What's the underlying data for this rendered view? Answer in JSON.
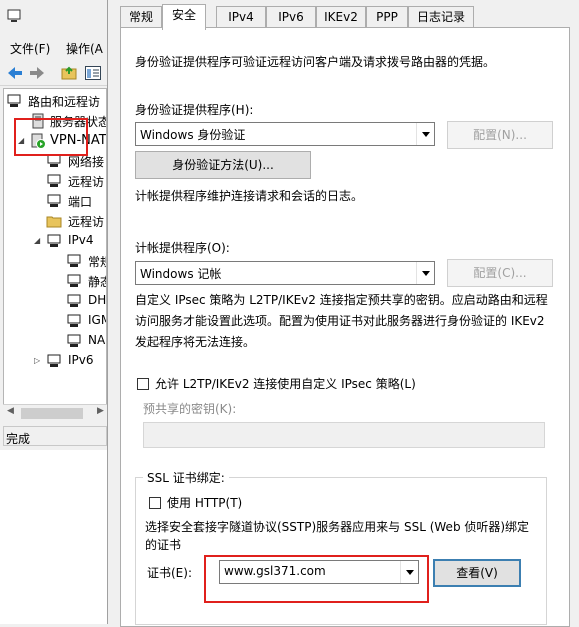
{
  "mmc": {
    "menu": {
      "file": "文件(F)",
      "action": "操作(A"
    },
    "tree": {
      "root": "路由和远程访",
      "server_status": "服务器状态",
      "server": "VPN-NAT",
      "items": [
        "网络接",
        "远程访",
        "端口",
        "远程访"
      ],
      "ipv4": "IPv4",
      "ipv4_items": [
        "常规",
        "静态",
        "DH",
        "IGM",
        "NA"
      ],
      "ipv6": "IPv6"
    },
    "status": "完成"
  },
  "dialog": {
    "tabs": [
      "常规",
      "安全",
      "IPv4",
      "IPv6",
      "IKEv2",
      "PPP",
      "日志记录"
    ],
    "active_tab": 1,
    "security": {
      "intro": "身份验证提供程序可验证远程访问客户端及请求拨号路由器的凭据。",
      "auth_provider_label": "身份验证提供程序(H):",
      "auth_provider_value": "Windows 身份验证",
      "auth_config_button": "配置(N)...",
      "auth_methods_button": "身份验证方法(U)...",
      "accounting_desc": "计帐提供程序维护连接请求和会话的日志。",
      "accounting_label": "计帐提供程序(O):",
      "accounting_value": "Windows 记帐",
      "accounting_config_button": "配置(C)...",
      "ipsec_desc_1": "自定义 IPsec 策略为 L2TP/IKEv2 连接指定预共享的密钥。应启动路由和远程",
      "ipsec_desc_2": "访问服务才能设置此选项。配置为使用证书对此服务器进行身份验证的 IKEv2",
      "ipsec_desc_3": "发起程序将无法连接。",
      "allow_custom_ipsec": "允许 L2TP/IKEv2 连接使用自定义 IPsec 策略(L)",
      "psk_label": "预共享的密钥(K):",
      "ssl_group_title": "SSL 证书绑定:",
      "use_http": "使用 HTTP(T)",
      "sstp_desc_1": "选择安全套接字隧道协议(SSTP)服务器应用来与 SSL (Web 侦听器)绑定",
      "sstp_desc_2": "的证书",
      "cert_label": "证书(E):",
      "cert_value": "www.gsl371.com",
      "view_button": "查看(V)"
    }
  },
  "colors": {
    "highlight_box": "#e0201c",
    "focus_border": "#3c7fb1"
  }
}
